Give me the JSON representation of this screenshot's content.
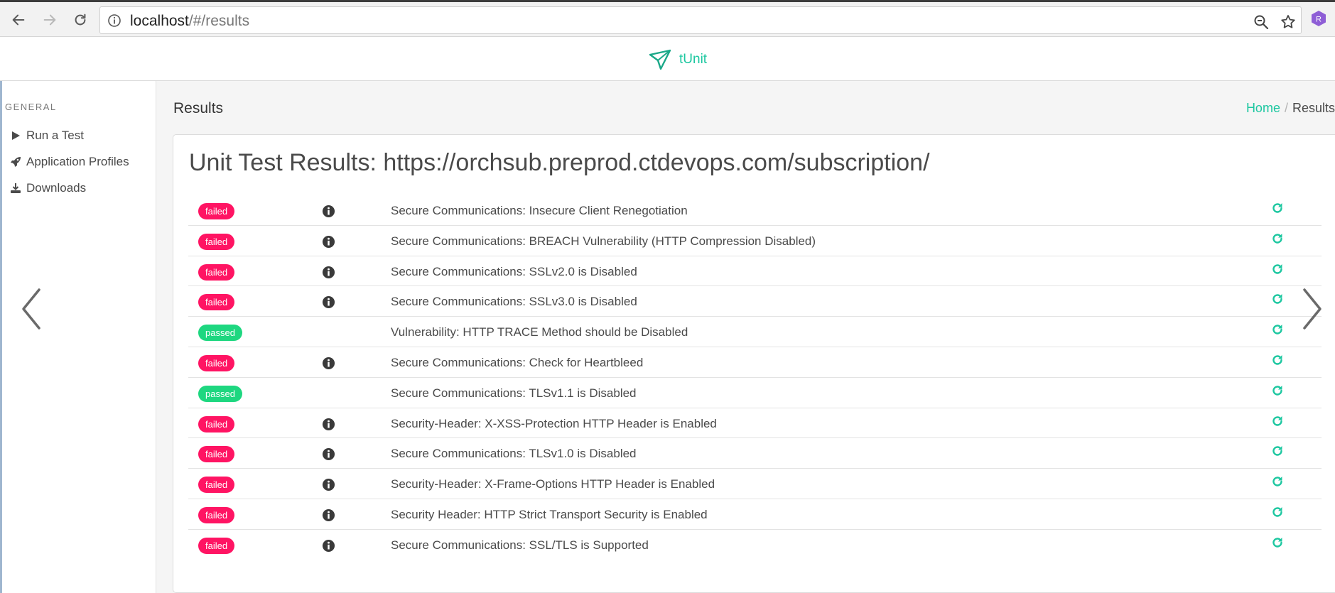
{
  "browser": {
    "url_host": "localhost",
    "url_path": "/#/results",
    "profile_initial": "R",
    "profile_color": "#8e5ed6"
  },
  "app": {
    "name": "tUnit",
    "accent_color": "#1cc7a0"
  },
  "sidebar": {
    "heading": "GENERAL",
    "items": [
      {
        "label": "Run a Test",
        "icon": "play-icon"
      },
      {
        "label": "Application Profiles",
        "icon": "rocket-icon"
      },
      {
        "label": "Downloads",
        "icon": "download-icon"
      }
    ]
  },
  "main": {
    "title": "Results",
    "breadcrumb": {
      "home": "Home",
      "separator": "/",
      "current": "Results"
    },
    "card_title": "Unit Test Results: https://orchsub.preprod.ctdevops.com/subscription/"
  },
  "results": [
    {
      "status": "failed",
      "info": true,
      "label": "Secure Communications: Insecure Client Renegotiation"
    },
    {
      "status": "failed",
      "info": true,
      "label": "Secure Communications: BREACH Vulnerability (HTTP Compression Disabled)"
    },
    {
      "status": "failed",
      "info": true,
      "label": "Secure Communications: SSLv2.0 is Disabled"
    },
    {
      "status": "failed",
      "info": true,
      "label": "Secure Communications: SSLv3.0 is Disabled"
    },
    {
      "status": "passed",
      "info": false,
      "label": "Vulnerability: HTTP TRACE Method should be Disabled"
    },
    {
      "status": "failed",
      "info": true,
      "label": "Secure Communications: Check for Heartbleed"
    },
    {
      "status": "passed",
      "info": false,
      "label": "Secure Communications: TLSv1.1 is Disabled"
    },
    {
      "status": "failed",
      "info": true,
      "label": "Security-Header: X-XSS-Protection HTTP Header is Enabled"
    },
    {
      "status": "failed",
      "info": true,
      "label": "Secure Communications: TLSv1.0 is Disabled"
    },
    {
      "status": "failed",
      "info": true,
      "label": "Security-Header: X-Frame-Options HTTP Header is Enabled"
    },
    {
      "status": "failed",
      "info": true,
      "label": "Security Header: HTTP Strict Transport Security is Enabled"
    },
    {
      "status": "failed",
      "info": true,
      "label": "Secure Communications: SSL/TLS is Supported"
    }
  ],
  "status_colors": {
    "failed": "#ff1463",
    "passed": "#1ed780"
  }
}
